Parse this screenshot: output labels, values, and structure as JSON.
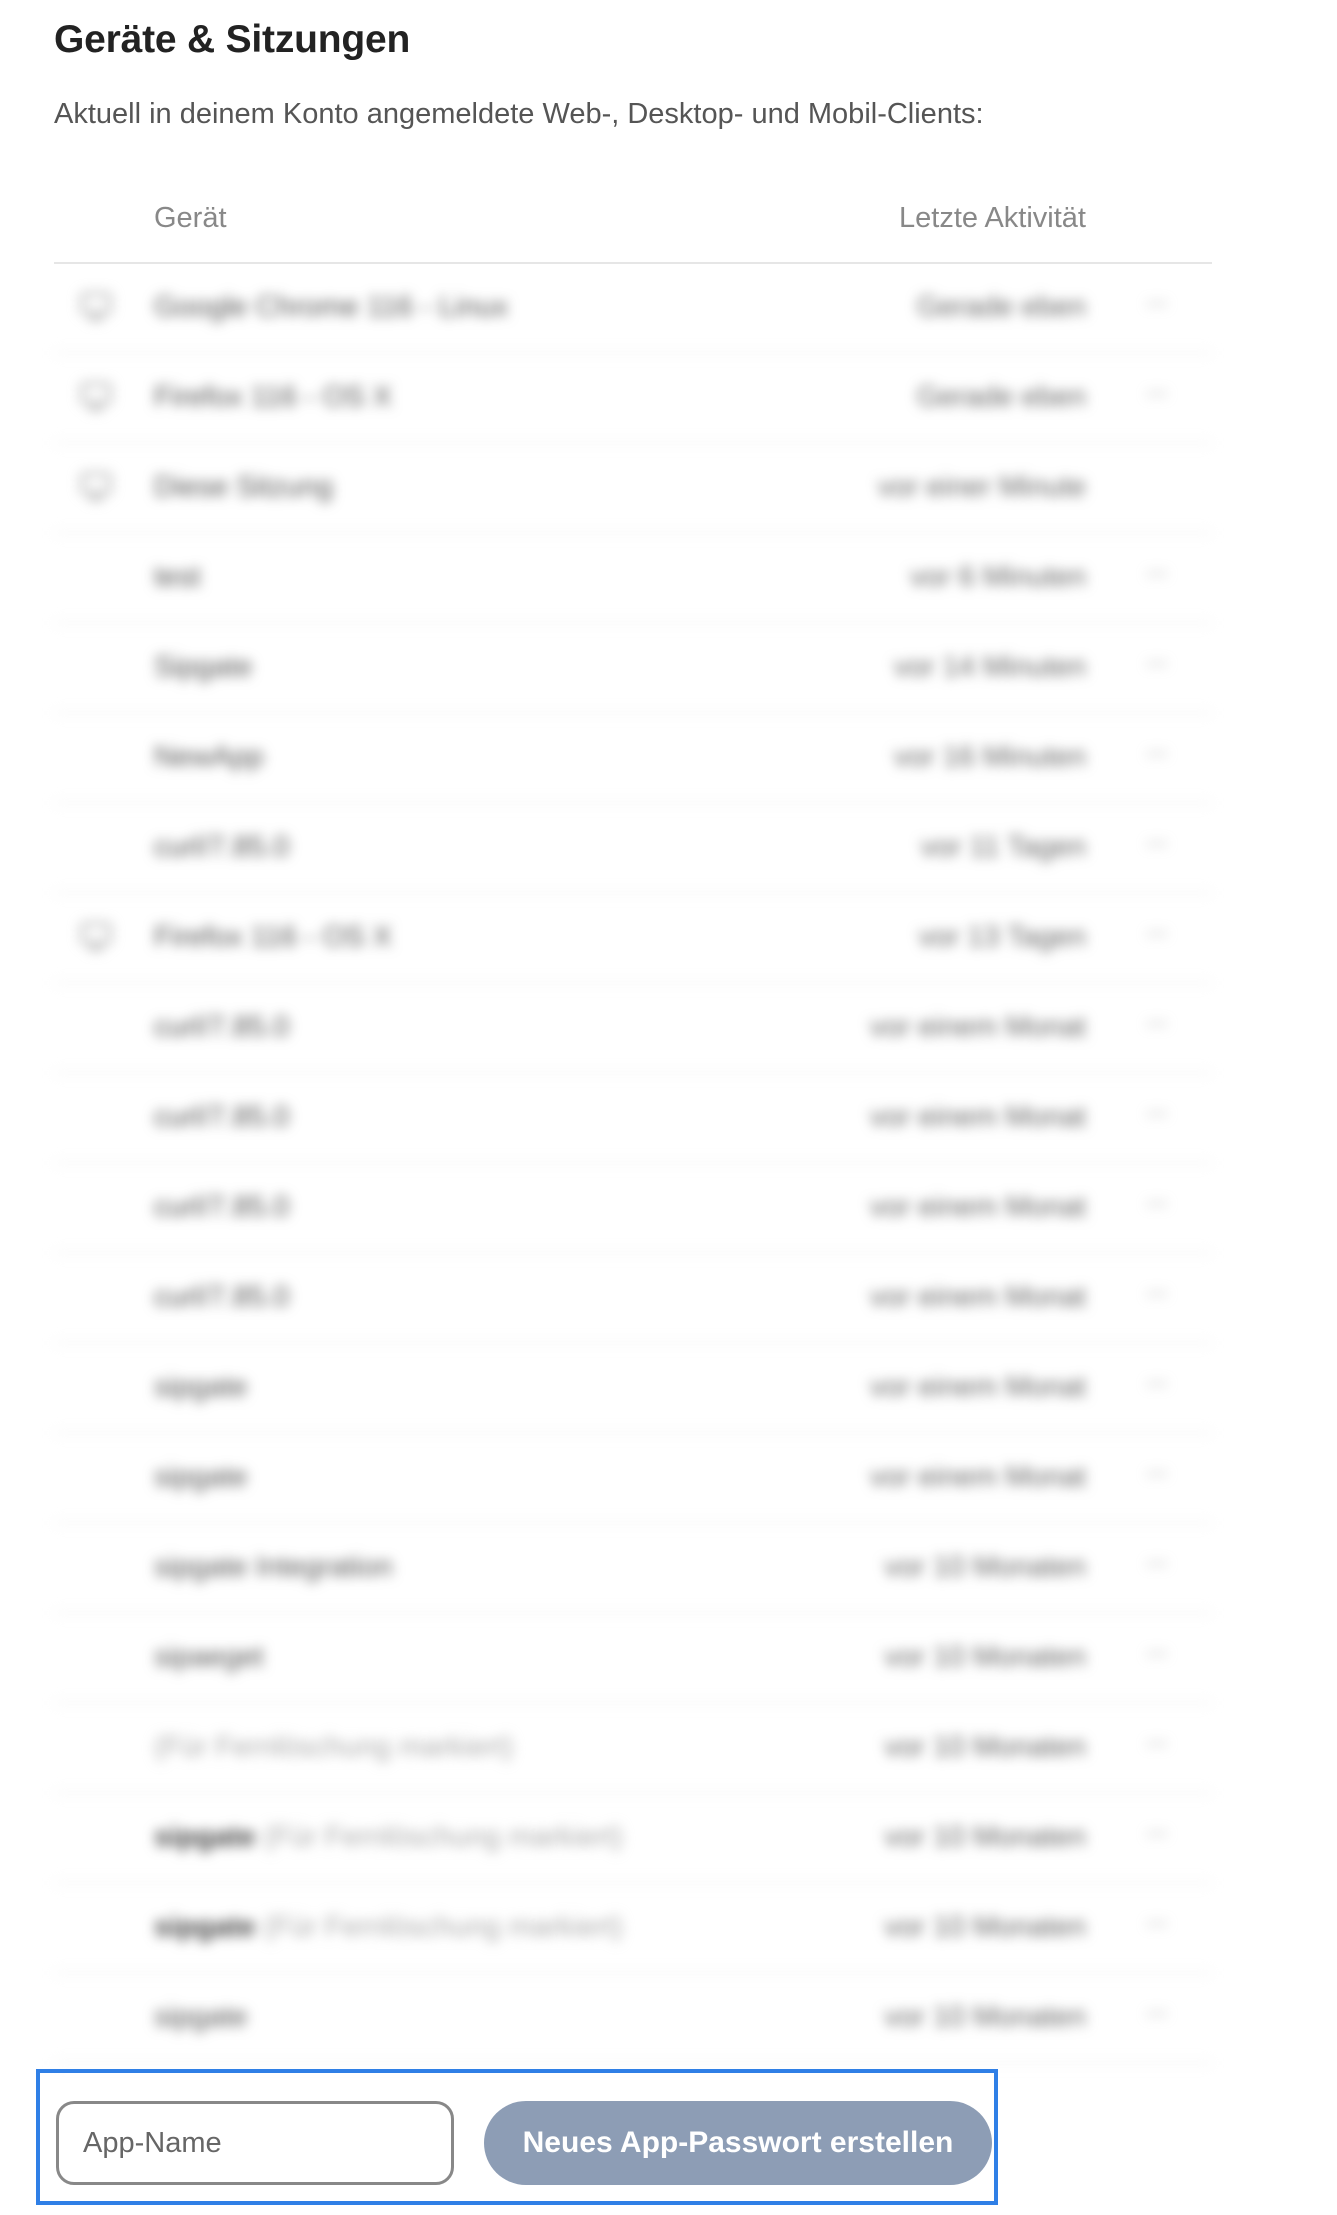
{
  "section": {
    "title": "Geräte & Sitzungen",
    "description": "Aktuell in deinem Konto angemeldete Web-, Desktop- und Mobil-Clients:"
  },
  "table": {
    "headers": {
      "device": "Gerät",
      "activity": "Letzte Aktivität"
    },
    "rows": [
      {
        "name": "Google Chrome 116 - Linux",
        "activity": "Gerade eben",
        "icon": "monitor-icon",
        "menu": true
      },
      {
        "name": "Firefox 116 - OS X",
        "activity": "Gerade eben",
        "icon": "monitor-icon",
        "menu": true
      },
      {
        "name": "Diese Sitzung",
        "activity": "vor einer Minute",
        "icon": "monitor-icon",
        "menu": false
      },
      {
        "name": "test",
        "activity": "vor 6 Minuten",
        "icon": "",
        "menu": true
      },
      {
        "name": "Sipgate",
        "activity": "vor 14 Minuten",
        "icon": "",
        "menu": true
      },
      {
        "name": "NewApp",
        "activity": "vor 16 Minuten",
        "icon": "",
        "menu": true
      },
      {
        "name": "curl/7.85.0",
        "activity": "vor 11 Tagen",
        "icon": "",
        "menu": true
      },
      {
        "name": "Firefox 116 - OS X",
        "activity": "vor 13 Tagen",
        "icon": "monitor-icon",
        "menu": true
      },
      {
        "name": "curl/7.85.0",
        "activity": "vor einem Monat",
        "icon": "",
        "menu": true
      },
      {
        "name": "curl/7.85.0",
        "activity": "vor einem Monat",
        "icon": "",
        "menu": true
      },
      {
        "name": "curl/7.85.0",
        "activity": "vor einem Monat",
        "icon": "",
        "menu": true
      },
      {
        "name": "curl/7.85.0",
        "activity": "vor einem Monat",
        "icon": "",
        "menu": true
      },
      {
        "name": "sipgate",
        "activity": "vor einem Monat",
        "icon": "",
        "menu": true
      },
      {
        "name": "sipgate",
        "activity": "vor einem Monat",
        "icon": "",
        "menu": true
      },
      {
        "name": "sipgate Integration",
        "activity": "vor 10 Monaten",
        "icon": "",
        "menu": true
      },
      {
        "name": "sipaeget",
        "activity": "vor 10 Monaten",
        "icon": "",
        "menu": true
      },
      {
        "name": "",
        "note": "(Für Fernlöschung markiert)",
        "activity": "vor 10 Monaten",
        "icon": "",
        "menu": true
      },
      {
        "name": "sipgate",
        "note": "(Für Fernlöschung markiert)",
        "activity": "vor 10 Monaten",
        "icon": "",
        "menu": true
      },
      {
        "name": "sipgate",
        "note": "(Für Fernlöschung markiert)",
        "activity": "vor 10 Monaten",
        "icon": "",
        "menu": true
      },
      {
        "name": "sipgate",
        "activity": "vor 10 Monaten",
        "icon": "",
        "menu": true
      }
    ],
    "menu_glyph": "···"
  },
  "app_password": {
    "input_placeholder": "App-Name",
    "input_value": "",
    "create_label": "Neues App-Passwort erstellen"
  },
  "colors": {
    "highlight_border": "#2f7fe6",
    "button_background": "#8d9db5"
  }
}
